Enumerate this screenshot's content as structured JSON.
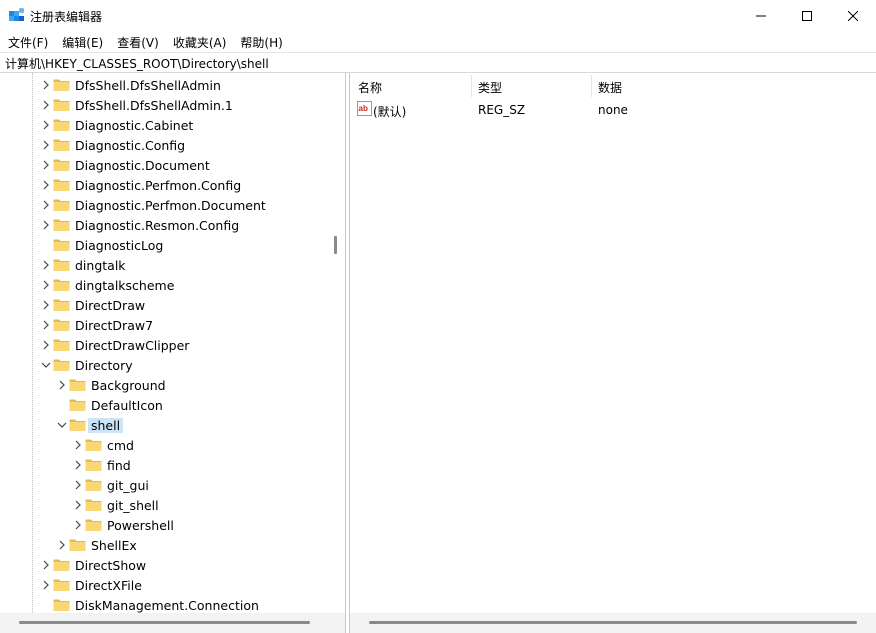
{
  "window": {
    "title": "注册表编辑器",
    "minimize_icon": "minimize-icon",
    "maximize_icon": "maximize-icon",
    "close_icon": "close-icon"
  },
  "menu": [
    "文件(F)",
    "编辑(E)",
    "查看(V)",
    "收藏夹(A)",
    "帮助(H)"
  ],
  "address": "计算机\\HKEY_CLASSES_ROOT\\Directory\\shell",
  "tree": {
    "items": [
      {
        "label": "DfsShell.DfsShellAdmin",
        "level": 0,
        "expander": "collapsed"
      },
      {
        "label": "DfsShell.DfsShellAdmin.1",
        "level": 0,
        "expander": "collapsed"
      },
      {
        "label": "Diagnostic.Cabinet",
        "level": 0,
        "expander": "collapsed"
      },
      {
        "label": "Diagnostic.Config",
        "level": 0,
        "expander": "collapsed"
      },
      {
        "label": "Diagnostic.Document",
        "level": 0,
        "expander": "collapsed"
      },
      {
        "label": "Diagnostic.Perfmon.Config",
        "level": 0,
        "expander": "collapsed"
      },
      {
        "label": "Diagnostic.Perfmon.Document",
        "level": 0,
        "expander": "collapsed"
      },
      {
        "label": "Diagnostic.Resmon.Config",
        "level": 0,
        "expander": "collapsed"
      },
      {
        "label": "DiagnosticLog",
        "level": 0,
        "expander": "none"
      },
      {
        "label": "dingtalk",
        "level": 0,
        "expander": "collapsed"
      },
      {
        "label": "dingtalkscheme",
        "level": 0,
        "expander": "collapsed"
      },
      {
        "label": "DirectDraw",
        "level": 0,
        "expander": "collapsed"
      },
      {
        "label": "DirectDraw7",
        "level": 0,
        "expander": "collapsed"
      },
      {
        "label": "DirectDrawClipper",
        "level": 0,
        "expander": "collapsed"
      },
      {
        "label": "Directory",
        "level": 0,
        "expander": "expanded"
      },
      {
        "label": "Background",
        "level": 1,
        "expander": "collapsed"
      },
      {
        "label": "DefaultIcon",
        "level": 1,
        "expander": "none"
      },
      {
        "label": "shell",
        "level": 1,
        "expander": "expanded",
        "selected": true
      },
      {
        "label": "cmd",
        "level": 2,
        "expander": "collapsed"
      },
      {
        "label": "find",
        "level": 2,
        "expander": "collapsed"
      },
      {
        "label": "git_gui",
        "level": 2,
        "expander": "collapsed"
      },
      {
        "label": "git_shell",
        "level": 2,
        "expander": "collapsed"
      },
      {
        "label": "Powershell",
        "level": 2,
        "expander": "collapsed"
      },
      {
        "label": "ShellEx",
        "level": 1,
        "expander": "collapsed"
      },
      {
        "label": "DirectShow",
        "level": 0,
        "expander": "collapsed"
      },
      {
        "label": "DirectXFile",
        "level": 0,
        "expander": "collapsed"
      },
      {
        "label": "DiskManagement.Connection",
        "level": 0,
        "expander": "none"
      }
    ],
    "folder_icon": "folder-icon"
  },
  "list": {
    "columns": [
      "名称",
      "类型",
      "数据"
    ],
    "rows": [
      {
        "name": "(默认)",
        "type": "REG_SZ",
        "data": "none",
        "icon": "string-value-icon"
      }
    ]
  },
  "colors": {
    "selection": "#cce4f7",
    "folder": "#f8d775",
    "folder_dark": "#e8b84a"
  }
}
